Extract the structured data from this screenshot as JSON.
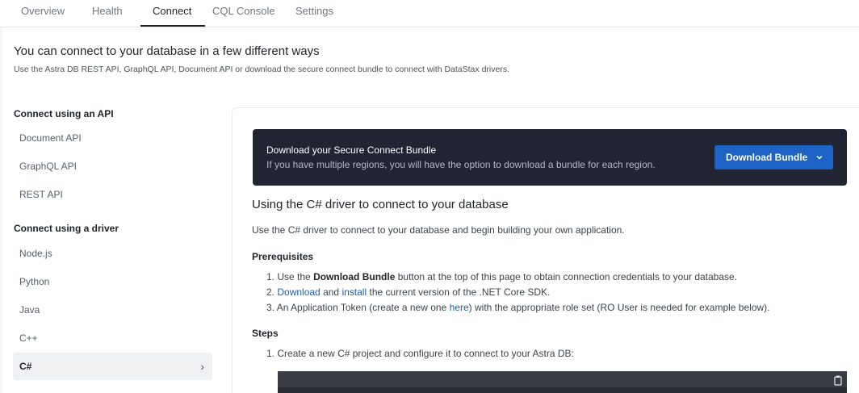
{
  "tabs": [
    {
      "label": "Overview"
    },
    {
      "label": "Health"
    },
    {
      "label": "Connect",
      "active": true
    },
    {
      "label": "CQL Console"
    },
    {
      "label": "Settings"
    }
  ],
  "header": {
    "title": "You can connect to your database in a few different ways",
    "subtitle": "Use the Astra DB REST API, GraphQL API, Document API or download the secure connect bundle to connect with DataStax drivers."
  },
  "sidebar": {
    "api_heading": "Connect using an API",
    "api_items": [
      {
        "label": "Document API"
      },
      {
        "label": "GraphQL API"
      },
      {
        "label": "REST API"
      }
    ],
    "driver_heading": "Connect using a driver",
    "driver_items": [
      {
        "label": "Node.js"
      },
      {
        "label": "Python"
      },
      {
        "label": "Java"
      },
      {
        "label": "C++"
      },
      {
        "label": "C#",
        "selected": true
      }
    ],
    "selected_chevron": "›"
  },
  "bundle": {
    "title": "Download your Secure Connect Bundle",
    "description": "If you have multiple regions, you will have the option to download a bundle for each region.",
    "button_label": "Download Bundle",
    "button_chevron": "⌄",
    "button_color": "#1d63c6",
    "banner_color": "#202433"
  },
  "content": {
    "heading": "Using the C# driver to connect to your database",
    "intro": "Use the C# driver to connect to your database and begin building your own application.",
    "prereq_heading": "Prerequisites",
    "prereqs": {
      "p1_num": "1.",
      "p1_a": "Use the",
      "p1_bold": "Download Bundle",
      "p1_b": "button at the top of this page to obtain connection credentials to your database.",
      "p2_num": "2.",
      "p2_link1": "Download",
      "p2_and": "and",
      "p2_link2": "install",
      "p2_rest": "the current version of the .NET Core SDK.",
      "p3_num": "3.",
      "p3_a": "An Application Token (create a new one",
      "p3_link": "here",
      "p3_b": ") with the appropriate role set (RO User is needed for example below)."
    },
    "steps_heading": "Steps",
    "steps": [
      {
        "num": "1.",
        "text": "Create a new C# project and configure it to connect to your Astra DB:"
      }
    ]
  },
  "icons": {
    "copy": "clipboard-icon",
    "link_color": "#1a5fb4"
  }
}
